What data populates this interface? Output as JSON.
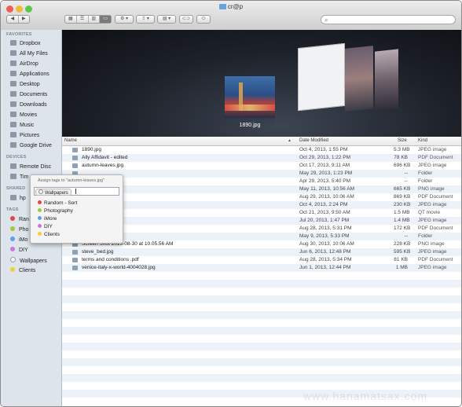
{
  "window": {
    "title": "cr@p"
  },
  "toolbar": {
    "back": "◀",
    "forward": "▶",
    "view_modes": [
      "▦",
      "☰",
      "▥",
      "▭"
    ],
    "action": "⚙ ▾",
    "share": "⇪ ▾",
    "arrange": "▤ ▾",
    "edit_tags": "⊂⊃",
    "tag": "⬭",
    "search_placeholder": ""
  },
  "sidebar": {
    "favorites_header": "FAVORITES",
    "favorites": [
      "Dropbox",
      "All My Files",
      "AirDrop",
      "Applications",
      "Desktop",
      "Documents",
      "Downloads",
      "Movies",
      "Music",
      "Pictures",
      "Google Drive"
    ],
    "devices_header": "DEVICES",
    "devices": [
      "Remote Disc",
      "Tim"
    ],
    "shared_header": "SHARED",
    "shared": [
      "hp"
    ],
    "tags_header": "TAGS",
    "tags": [
      {
        "label": "Ran",
        "color": "#e0483e"
      },
      {
        "label": "Pho",
        "color": "#9ccc3c"
      },
      {
        "label": "iMo",
        "color": "#5aa0e6"
      },
      {
        "label": "DIY",
        "color": "#c678dd"
      },
      {
        "label": "Wallpapers",
        "color": "#ffffff"
      },
      {
        "label": "Clients",
        "color": "#f5cf3a"
      }
    ]
  },
  "coverflow": {
    "selected_label": "1890.jpg"
  },
  "columns": {
    "name": "Name",
    "date": "Date Modified",
    "size": "Size",
    "kind": "Kind"
  },
  "files": [
    {
      "name": "1890.jpg",
      "date": "Oct 4, 2013, 1:55 PM",
      "size": "5.3 MB",
      "kind": "JPEG image"
    },
    {
      "name": "Ally Affidavit - edited",
      "date": "Oct 29, 2013, 1:22 PM",
      "size": "78 KB",
      "kind": "PDF Document"
    },
    {
      "name": "autumn-leaves.jpg",
      "date": "Oct 17, 2013, 9:11 AM",
      "size": "696 KB",
      "kind": "JPEG image"
    },
    {
      "name": "",
      "date": "May 29, 2013, 1:23 PM",
      "size": "--",
      "kind": "Folder"
    },
    {
      "name": "",
      "date": "Apr 29, 2013, 5:40 PM",
      "size": "--",
      "kind": "Folder"
    },
    {
      "name": "",
      "date": "May 11, 2013, 10:56 AM",
      "size": "665 KB",
      "kind": "PNG image"
    },
    {
      "name": "pdf",
      "date": "Aug 29, 2013, 10:06 AM",
      "size": "869 KB",
      "kind": "PDF Document"
    },
    {
      "name": "ness.jpg",
      "date": "Oct 4, 2013, 2:24 PM",
      "size": "230 KB",
      "kind": "JPEG image"
    },
    {
      "name": ".mov",
      "date": "Oct 21, 2013, 9:50 AM",
      "size": "1.5 MB",
      "kind": "QT movie"
    },
    {
      "name": ".jpeg",
      "date": "Jul 20, 2013, 1:47 PM",
      "size": "1.4 MB",
      "kind": "JPEG image"
    },
    {
      "name": "5536419.pdf",
      "date": "Aug 28, 2013, 5:31 PM",
      "size": "172 KB",
      "kind": "PDF Document"
    },
    {
      "name": "",
      "date": "May 9, 2013, 5:33 PM",
      "size": "--",
      "kind": "Folder"
    },
    {
      "name": "Screen Shot 2013-08-30 at 10.05.56 AM",
      "date": "Aug 30, 2013, 10:06 AM",
      "size": "228 KB",
      "kind": "PNG image"
    },
    {
      "name": "steve_bed.jpg",
      "date": "Jun 6, 2013, 12:48 PM",
      "size": "595 KB",
      "kind": "JPEG image"
    },
    {
      "name": "terms and conditions .pdf",
      "date": "Aug 28, 2013, 5:34 PM",
      "size": "81 KB",
      "kind": "PDF Document"
    },
    {
      "name": "venice-italy-x-world-4004028.jpg",
      "date": "Jun 1, 2013, 12:44 PM",
      "size": "1 MB",
      "kind": "JPEG image"
    }
  ],
  "tag_popup": {
    "title": "Assign tags to \"autumn-leaves.jpg\"",
    "chip": "Wallpapers",
    "options": [
      {
        "label": "Random - Sort",
        "color": "#e0483e"
      },
      {
        "label": "Photography",
        "color": "#9ccc3c"
      },
      {
        "label": "iMore",
        "color": "#5aa0e6"
      },
      {
        "label": "DIY",
        "color": "#c678dd"
      },
      {
        "label": "Clients",
        "color": "#f5cf3a"
      }
    ]
  },
  "watermark": "www.hanamatsax.com"
}
